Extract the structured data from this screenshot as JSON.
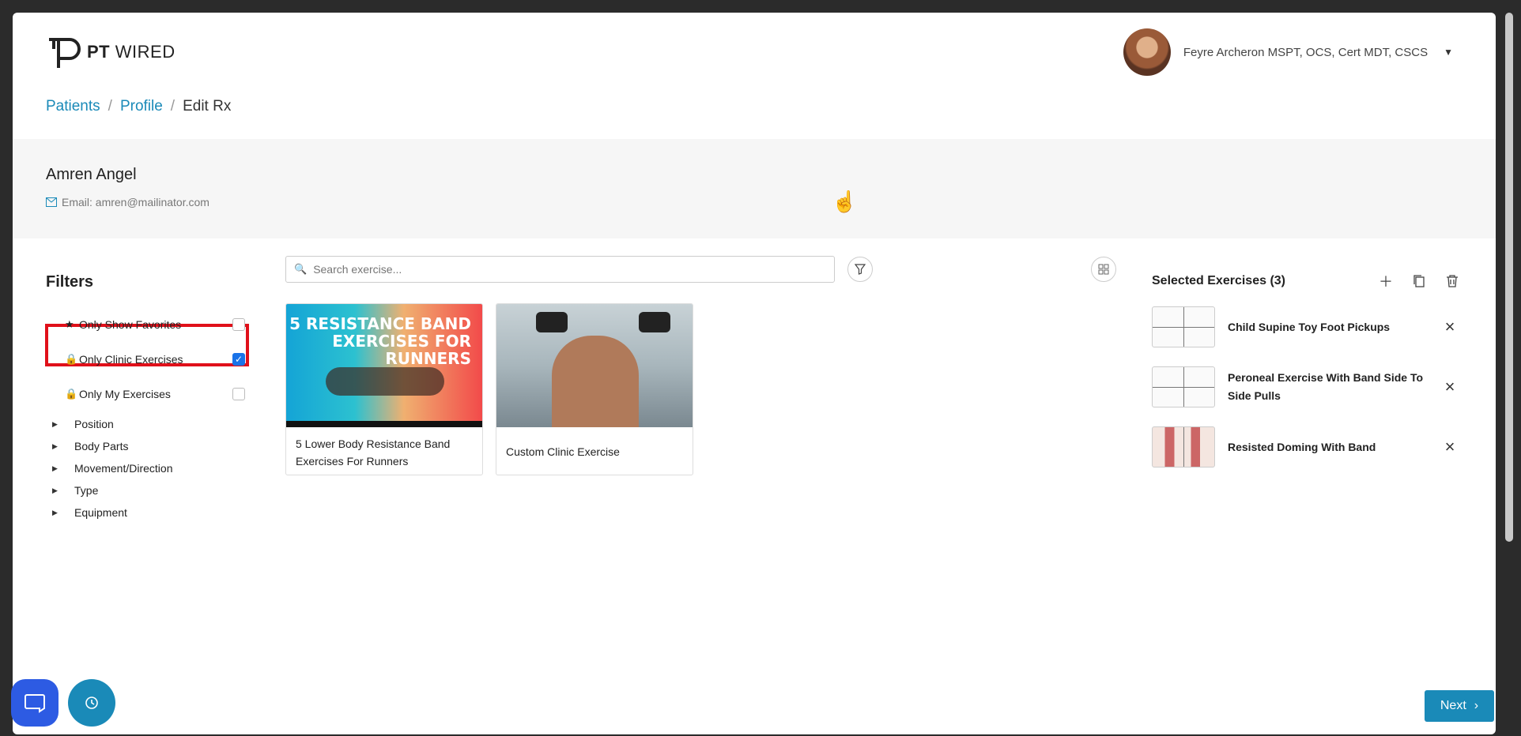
{
  "brand": {
    "logo_bold": "PT",
    "logo_rest": "WIRED"
  },
  "user": {
    "name": "Feyre Archeron MSPT, OCS, Cert MDT, CSCS",
    "caret": "▼"
  },
  "breadcrumb": {
    "items": [
      "Patients",
      "Profile",
      "Edit Rx"
    ],
    "separator": "/"
  },
  "patient": {
    "name": "Amren Angel",
    "email": "Email: amren@mailinator.com"
  },
  "filters": {
    "title": "Filters",
    "checks": [
      {
        "label": "Only Show Favorites",
        "icon": "star-icon",
        "checked": false
      },
      {
        "label": "Only Clinic Exercises",
        "icon": "lock-icon",
        "checked": true
      },
      {
        "label": "Only My Exercises",
        "icon": "lock-icon",
        "checked": false
      }
    ],
    "tree": [
      "Position",
      "Body Parts",
      "Movement/Direction",
      "Type",
      "Equipment"
    ]
  },
  "search": {
    "placeholder": "Search exercise..."
  },
  "cards": [
    {
      "title": "5 Lower Body Resistance Band Exercises For Runners",
      "banner": "5 RESISTANCE BAND EXERCISES FOR RUNNERS"
    },
    {
      "title": "Custom Clinic Exercise"
    }
  ],
  "selected": {
    "title": "Selected Exercises (3)",
    "items": [
      {
        "name": "Child Supine Toy Foot Pickups"
      },
      {
        "name": "Peroneal Exercise With Band Side To Side Pulls"
      },
      {
        "name": "Resisted Doming With Band"
      }
    ]
  },
  "actions": {
    "next": "Next"
  },
  "colors": {
    "accent": "#1a8ab8",
    "highlight": "#e0101a",
    "chat": "#2d5be3",
    "checkbox": "#1a73e8"
  }
}
